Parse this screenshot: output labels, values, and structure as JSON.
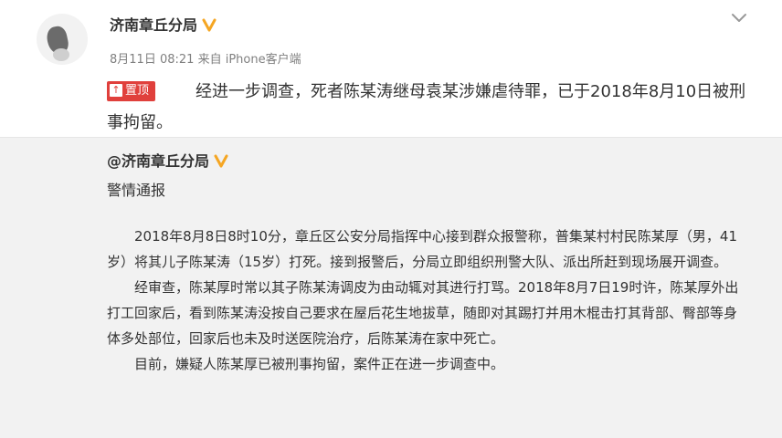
{
  "post": {
    "author": "济南章丘分局",
    "timestamp": "8月11日 08:21",
    "source_prefix": "来自",
    "source": "iPhone客户端",
    "pinned_label": "置顶",
    "text": "经进一步调查，死者陈某涛继母袁某涉嫌虐待罪，已于2018年8月10日被刑事拘留。"
  },
  "repost": {
    "author": "@济南章丘分局",
    "title": "警情通报",
    "paragraphs": [
      "2018年8月8日8时10分，章丘区公安分局指挥中心接到群众报警称，普集某村村民陈某厚（男，41岁）将其儿子陈某涛（15岁）打死。接到报警后，分局立即组织刑警大队、派出所赶到现场展开调查。",
      "经审查，陈某厚时常以其子陈某涛调皮为由动辄对其进行打骂。2018年8月7日19时许，陈某厚外出打工回家后，看到陈某涛没按自己要求在屋后花生地拔草，随即对其踢打并用木棍击打其背部、臀部等身体多处部位，回家后也未及时送医院治疗，后陈某涛在家中死亡。",
      "目前，嫌疑人陈某厚已被刑事拘留，案件正在进一步调查中。"
    ]
  },
  "icons": {
    "verified": "verified-badge-icon",
    "menu": "chevron-down-icon",
    "pin": "pin-icon"
  },
  "colors": {
    "pinned_badge": "#e0403c",
    "verified": "#f5a623",
    "repost_background": "#f2f2f2",
    "meta_text": "#808080"
  }
}
